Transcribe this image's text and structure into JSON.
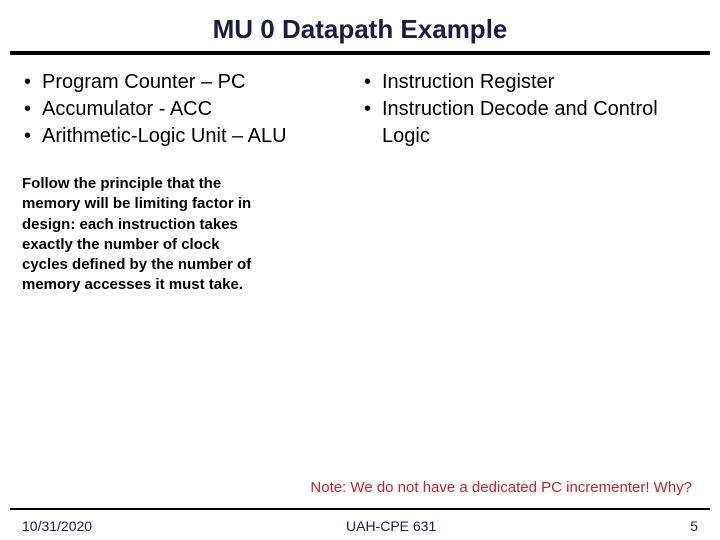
{
  "title": "MU 0 Datapath Example",
  "left_bullets": [
    "Program Counter – PC",
    "Accumulator - ACC",
    "Arithmetic-Logic Unit – ALU"
  ],
  "right_bullets": [
    "Instruction Register",
    "Instruction Decode and Control Logic"
  ],
  "principle": "Follow the principle that the memory will be limiting factor in design: each instruction takes exactly the number of clock cycles defined by the number of memory accesses it must take.",
  "note": "Note: We do not have a dedicated PC incrementer! Why?",
  "footer": {
    "date": "10/31/2020",
    "center": "UAH-CPE 631",
    "page": "5"
  }
}
